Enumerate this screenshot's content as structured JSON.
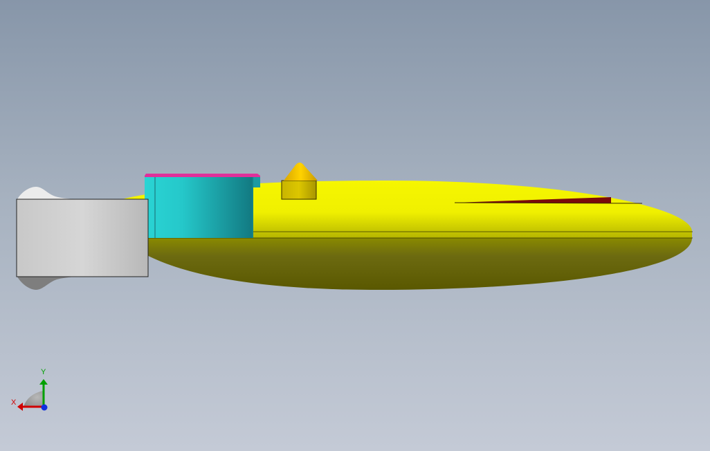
{
  "viewport": {
    "background_top": "#8796a9",
    "background_bottom": "#c4cad6"
  },
  "model": {
    "parts": [
      {
        "name": "yellow-elliptical-body",
        "color": "#eded00"
      },
      {
        "name": "cyan-cylinder",
        "color": "#22cfcf"
      },
      {
        "name": "magenta-rim",
        "color": "#e0309a"
      },
      {
        "name": "gray-end-block",
        "color": "#d2d2d2"
      },
      {
        "name": "cone-tip",
        "color": "#f0c400"
      },
      {
        "name": "dark-red-wedge",
        "color": "#7a0a0a"
      }
    ]
  },
  "triad": {
    "x_label": "X",
    "y_label": "Y",
    "x_color": "#d00000",
    "y_color": "#00a000",
    "z_color": "#1030e0"
  }
}
